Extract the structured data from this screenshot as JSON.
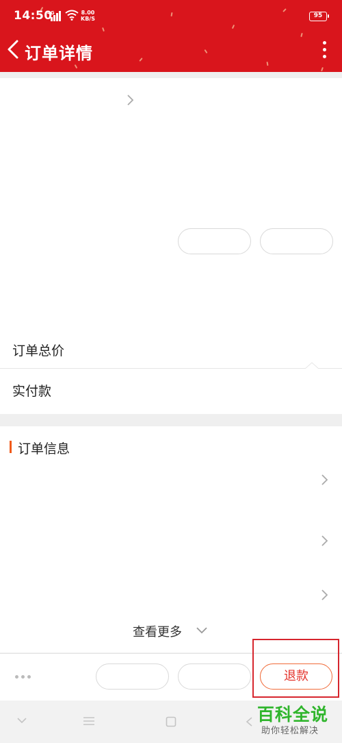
{
  "status_bar": {
    "time": "14:50",
    "network": "4G",
    "speed_value": "8.00",
    "speed_unit": "KB/S",
    "battery": "95"
  },
  "header": {
    "title": "订单详情",
    "back_icon": "chevron-left-icon",
    "menu_icon": "more-vertical-icon",
    "background_color": "#d9151c"
  },
  "order_summary": {
    "total_label": "订单总价",
    "paid_label": "实付款"
  },
  "order_info": {
    "title": "订单信息",
    "accent_color": "#f05a1a",
    "see_more_label": "查看更多"
  },
  "actions": {
    "refund_label": "退款",
    "refund_color": "#e4322b"
  },
  "watermark": {
    "brand": "百科全说",
    "tagline": "助你轻松解决",
    "brand_color": "#2fb52c"
  }
}
